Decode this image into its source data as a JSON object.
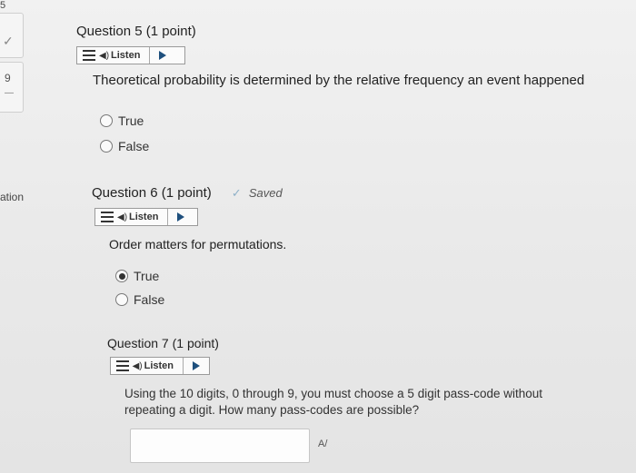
{
  "rail": {
    "top_fragment": "5",
    "check_mark": "✓",
    "number": "9",
    "dash": "—",
    "section_label": "ation"
  },
  "listen_label": "Listen",
  "questions": [
    {
      "title": "Question 5 (1 point)",
      "text": "Theoretical probability is determined by the relative frequency an event happened",
      "choices": [
        {
          "label": "True",
          "selected": false
        },
        {
          "label": "False",
          "selected": false
        }
      ]
    },
    {
      "title": "Question 6 (1 point)",
      "status": "Saved",
      "text": "Order matters for permutations.",
      "choices": [
        {
          "label": "True",
          "selected": true
        },
        {
          "label": "False",
          "selected": false
        }
      ]
    },
    {
      "title": "Question 7 (1 point)",
      "text_line1": "Using the 10 digits, 0 through 9, you must choose a 5 digit pass-code without",
      "text_line2": "repeating a digit. How many pass-codes are possible?",
      "answer_value": ""
    }
  ],
  "icons": {
    "menu": "menu-icon",
    "speaker": "speaker-icon",
    "play": "play-icon",
    "saved": "checkmark-icon",
    "spellcheck": "spellcheck-icon"
  }
}
